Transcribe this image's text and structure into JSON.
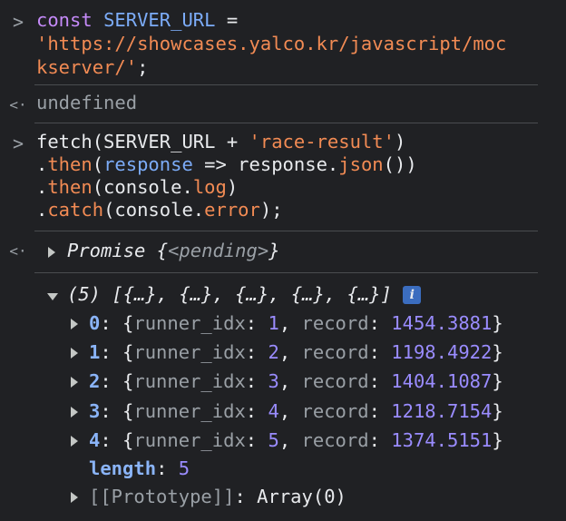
{
  "entry1": {
    "prompt": ">",
    "const_kw": "const",
    "var_name": "SERVER_URL",
    "assign": " =",
    "url_part1": "'https://showcases.yalco.kr/javascript/moc",
    "url_part2": "kserver/'",
    "semicolon": ";"
  },
  "result1": {
    "prompt": "<·",
    "text": "undefined"
  },
  "entry2": {
    "prompt": ">",
    "l1_fetch": "fetch",
    "l1_args": "(SERVER_URL + ",
    "l1_str": "'race-result'",
    "l1_close": ")",
    "l2_dot": ".",
    "l2_then": "then",
    "l2_open": "(",
    "l2_param": "response",
    "l2_arrow": " => response.",
    "l2_json": "json",
    "l2_close": "())",
    "l3_dot": ".",
    "l3_then": "then",
    "l3_args": "(console.",
    "l3_log": "log",
    "l3_close": ")",
    "l4_dot": ".",
    "l4_catch": "catch",
    "l4_args": "(console.",
    "l4_error": "error",
    "l4_close": ");"
  },
  "result2": {
    "prompt": "<·",
    "promise_label": "Promise",
    "promise_open": " {",
    "promise_state": "<pending>",
    "promise_close": "}"
  },
  "array_log": {
    "summary": "(5) [{…}, {…}, {…}, {…}, {…}]",
    "info_icon": "i",
    "items": [
      {
        "index": "0",
        "key1": "runner_idx",
        "val1": "1",
        "key2": "record",
        "val2": "1454.3881"
      },
      {
        "index": "1",
        "key1": "runner_idx",
        "val1": "2",
        "key2": "record",
        "val2": "1198.4922"
      },
      {
        "index": "2",
        "key1": "runner_idx",
        "val1": "3",
        "key2": "record",
        "val2": "1404.1087"
      },
      {
        "index": "3",
        "key1": "runner_idx",
        "val1": "4",
        "key2": "record",
        "val2": "1218.7154"
      },
      {
        "index": "4",
        "key1": "runner_idx",
        "val1": "5",
        "key2": "record",
        "val2": "1374.5151"
      }
    ],
    "length_key": "length",
    "length_val": "5",
    "prototype_key": "[[Prototype]]",
    "prototype_val": "Array(0)"
  }
}
